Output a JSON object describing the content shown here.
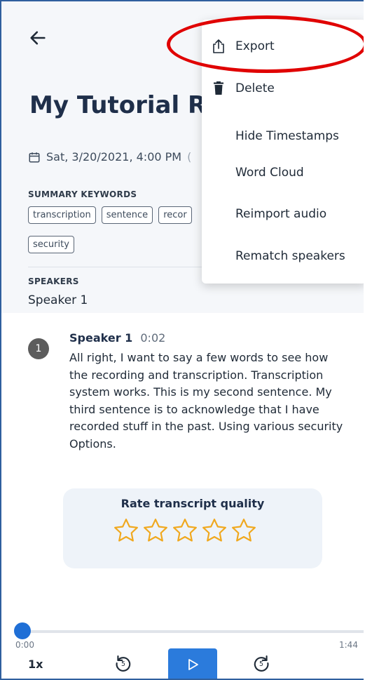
{
  "menu": {
    "items": [
      {
        "label": "Export",
        "icon": "export-icon"
      },
      {
        "label": "Delete",
        "icon": "trash-icon"
      },
      {
        "label": "Hide Timestamps"
      },
      {
        "label": "Word Cloud"
      },
      {
        "label": "Reimport audio"
      },
      {
        "label": "Rematch speakers"
      }
    ]
  },
  "page": {
    "title": "My Tutorial Re",
    "date": "Sat, 3/20/2021, 4:00 PM",
    "date_trail": "("
  },
  "summary": {
    "label": "SUMMARY KEYWORDS",
    "keywords": [
      "transcription",
      "sentence",
      "recor",
      "security"
    ]
  },
  "speakers": {
    "label": "SPEAKERS",
    "name": "Speaker 1"
  },
  "transcript": {
    "avatar_number": "1",
    "speaker": "Speaker 1",
    "timestamp": "0:02",
    "text": "All right, I want to say a few words to see how the recording and transcription. Transcription system works. This is my second sentence. My third sentence is to acknowledge that I have recorded stuff in the past. Using various security Options."
  },
  "rating": {
    "title": "Rate transcript quality",
    "max_stars": 5,
    "value": 0,
    "star_color": "#f0a81e"
  },
  "player": {
    "current_time": "0:00",
    "total_time": "1:44",
    "speed": "1x",
    "progress": 0,
    "rewind_seconds": "5",
    "forward_seconds": "5",
    "accent": "#2b7bdc"
  },
  "annotation": {
    "highlight_color": "#e00000"
  }
}
